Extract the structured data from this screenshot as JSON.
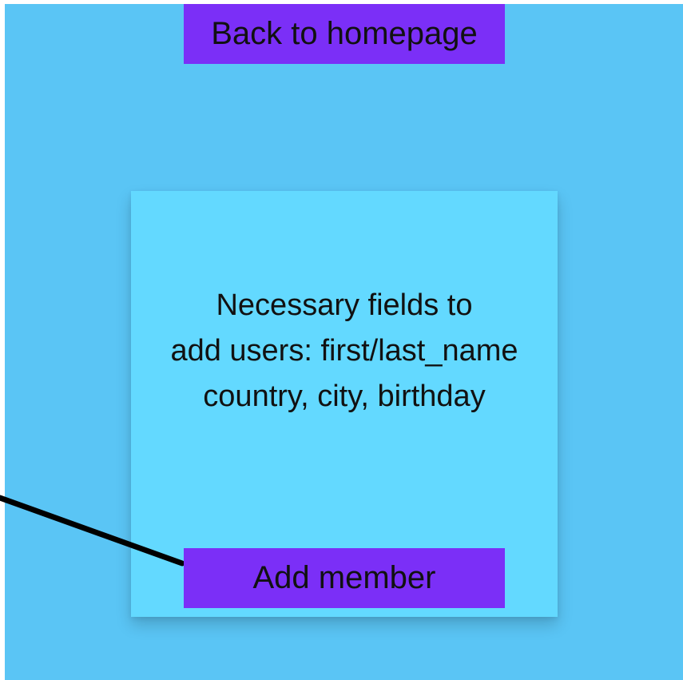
{
  "nav": {
    "back_label": "Back to homepage"
  },
  "card": {
    "lines": [
      "Necessary fields to",
      "add users: first/last_name",
      "country, city, birthday"
    ]
  },
  "actions": {
    "add_label": "Add member"
  },
  "colors": {
    "background": "#5ac5f5",
    "card": "#63d9ff",
    "button": "#7b2ff7",
    "text": "#111111",
    "connector": "#000000"
  }
}
